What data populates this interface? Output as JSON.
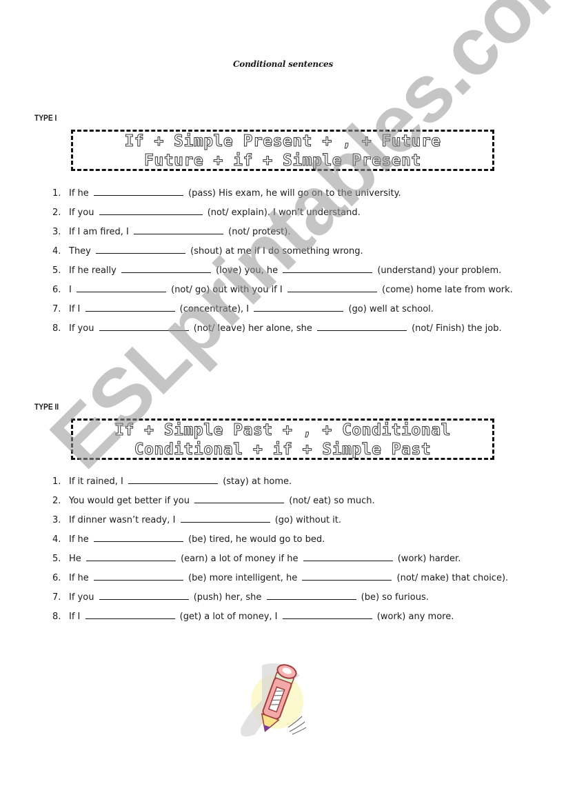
{
  "title": "Conditional sentences",
  "watermark": "ESLprintables.com",
  "sections": [
    {
      "label": "TYPE I",
      "formula": [
        "If + Simple Present + , + Future",
        "Future + if + Simple Present"
      ],
      "items": [
        {
          "n": "1.",
          "parts": [
            "If he",
            "(pass)  His exam, he will go on to the university."
          ]
        },
        {
          "n": "2.",
          "parts": [
            "If you",
            "(not/ explain). I won’t understand."
          ]
        },
        {
          "n": "3.",
          "parts": [
            "If I am fired, I",
            "(not/ protest)."
          ]
        },
        {
          "n": "4.",
          "parts": [
            "They",
            "(shout) at me if I do something wrong."
          ]
        },
        {
          "n": "5.",
          "parts": [
            "If he really",
            "(love) you, he",
            "(understand) your problem."
          ]
        },
        {
          "n": "6.",
          "parts": [
            "I",
            "(not/ go) out with you if I",
            "(come) home late from work."
          ]
        },
        {
          "n": "7.",
          "parts": [
            "If I",
            "(concentrate), I",
            "(go) well at school."
          ]
        },
        {
          "n": "8.",
          "parts": [
            "If you",
            "(not/ leave) her alone, she",
            "(not/ Finish) the job."
          ]
        }
      ]
    },
    {
      "label": "TYPE II",
      "formula": [
        "If + Simple Past + , + Conditional",
        "Conditional + if + Simple Past"
      ],
      "items": [
        {
          "n": "1.",
          "parts": [
            "If it rained, I",
            "(stay) at home."
          ]
        },
        {
          "n": "2.",
          "parts": [
            "You would get better if you",
            "(not/ eat) so much."
          ]
        },
        {
          "n": "3.",
          "parts": [
            "If dinner wasn’t ready, I",
            "(go) without it."
          ]
        },
        {
          "n": "4.",
          "parts": [
            "If he",
            "(be) tired, he would go to bed."
          ]
        },
        {
          "n": "5.",
          "parts": [
            "He",
            "(earn) a lot of money if he",
            "(work) harder."
          ]
        },
        {
          "n": "6.",
          "parts": [
            "If he",
            "(be) more intelligent, he",
            "(not/ make) that choice)."
          ]
        },
        {
          "n": "7.",
          "parts": [
            "If you",
            "(push) her, she",
            "(be) so furious."
          ]
        },
        {
          "n": "8.",
          "parts": [
            "If I",
            "(get) a lot of money, I",
            "(work) any more."
          ]
        }
      ]
    }
  ],
  "illustration": "pencil-icon"
}
